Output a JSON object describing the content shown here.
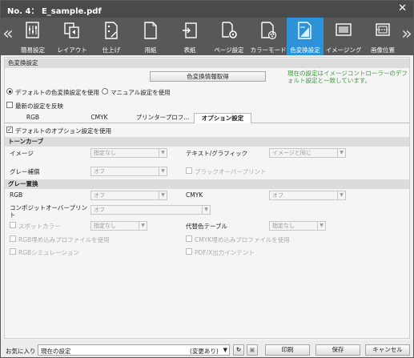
{
  "window": {
    "title": "No. 4： E_sample.pdf",
    "close": "✕"
  },
  "ribbon": {
    "prev": "«",
    "next": "»",
    "tabs": [
      {
        "label": "簡易設定",
        "icon": "quick-settings-icon"
      },
      {
        "label": "レイアウト",
        "icon": "layout-icon"
      },
      {
        "label": "仕上げ",
        "icon": "finishing-icon"
      },
      {
        "label": "用紙",
        "icon": "paper-icon"
      },
      {
        "label": "表紙",
        "icon": "cover-icon"
      },
      {
        "label": "ページ設定",
        "icon": "page-setting-icon"
      },
      {
        "label": "カラーモード",
        "icon": "color-mode-icon"
      },
      {
        "label": "色変換設定",
        "icon": "color-conversion-icon",
        "active": true
      },
      {
        "label": "イメージング",
        "icon": "imaging-icon"
      },
      {
        "label": "画像位置",
        "icon": "image-position-icon"
      }
    ]
  },
  "color_conv": {
    "section_title": "色変換設定",
    "get_info_button": "色変換情報取得",
    "note": "現在の設定はイメージコントローラーのデフォルト設定と一致しています。",
    "radio_default": "デフォルトの色変換設定を使用",
    "radio_manual": "マニュアル設定を使用",
    "reflect_latest": "最新の設定を反映",
    "subtabs": [
      "RGB",
      "CMYK",
      "プリンタープロフ...",
      "オプション設定"
    ],
    "use_default_option": "デフォルトのオプション設定を使用",
    "tone_curve": {
      "title": "トーンカーブ",
      "image_label": "イメージ",
      "image_value": "指定なし",
      "text_label": "テキスト/グラフィック",
      "text_value": "イメージと同じ"
    },
    "gray_comp": {
      "label": "グレー補償",
      "value": "オフ",
      "black_overprint": "ブラックオーバープリント"
    },
    "gray_replace": {
      "title": "グレー置換",
      "rgb_label": "RGB",
      "rgb_value": "オフ",
      "cmyk_label": "CMYK",
      "cmyk_value": "オフ"
    },
    "composite": {
      "label": "コンポジットオーバープリント",
      "value": "オフ"
    },
    "spot": {
      "label": "スポットカラー",
      "value": "指定なし",
      "sub_label": "代替色テーブル",
      "sub_value": "指定なし"
    },
    "rgb_embed": "RGB埋め込みプロファイルを使用",
    "cmyk_embed": "CMYK埋め込みプロファイルを使用",
    "rgb_sim": "RGBシミュレーション",
    "pdfx": "PDF/X出力インテント"
  },
  "footer": {
    "fav_label": "お気に入り",
    "fav_value": "現在の設定",
    "fav_changed": "(変更あり)",
    "print": "印刷",
    "save": "保存",
    "cancel": "キャンセル"
  }
}
